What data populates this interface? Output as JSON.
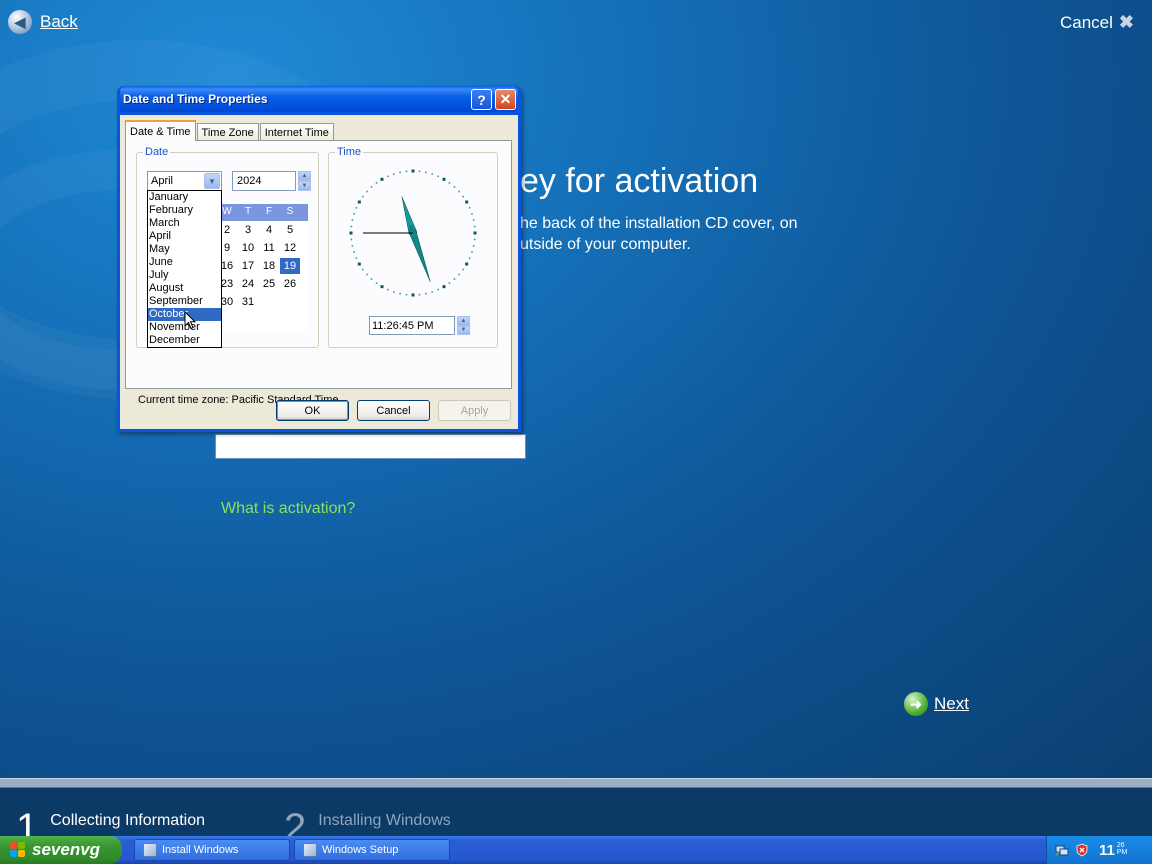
{
  "setup": {
    "back_label": "Back",
    "cancel_label": "Cancel",
    "heading": "ey for activation",
    "desc_line1": "he back of the installation CD cover, on",
    "desc_line2": "utside of your computer.",
    "what_link": "What is activation?",
    "next_label": "Next"
  },
  "steps": [
    {
      "num": "1",
      "label": "Collecting Information"
    },
    {
      "num": "2",
      "label": "Installing Windows"
    }
  ],
  "taskbar": {
    "start_label": "sevenvg",
    "tasks": [
      "Install Windows",
      "Windows Setup"
    ],
    "clock_hour": "11",
    "clock_min": "26",
    "clock_ampm": "PM"
  },
  "dialog": {
    "title": "Date and Time Properties",
    "help_glyph": "?",
    "close_glyph": "✕",
    "tabs": [
      "Date & Time",
      "Time Zone",
      "Internet Time"
    ],
    "date_group": "Date",
    "time_group": "Time",
    "month_value": "April",
    "year_value": "2024",
    "weekday_headers": [
      "W",
      "T",
      "F",
      "S"
    ],
    "calendar_rows": [
      [
        "2",
        "3",
        "4",
        "5"
      ],
      [
        "9",
        "10",
        "11",
        "12"
      ],
      [
        "16",
        "17",
        "18",
        "19"
      ],
      [
        "23",
        "24",
        "25",
        "26"
      ],
      [
        "30",
        "31",
        "",
        ""
      ]
    ],
    "selected_day": "19",
    "months": [
      "January",
      "February",
      "March",
      "April",
      "May",
      "June",
      "July",
      "August",
      "September",
      "October",
      "November",
      "December"
    ],
    "highlighted_month": "October",
    "time_value": "11:26:45 PM",
    "timezone_text": "Current time zone:  Pacific Standard Time",
    "ok_label": "OK",
    "cancel_label": "Cancel",
    "apply_label": "Apply"
  },
  "clock": {
    "hour": 11,
    "minute": 26,
    "second": 45
  },
  "colors": {
    "accent_blue": "#0a54e0",
    "link_green": "#8ee05a",
    "selection": "#316ac5"
  }
}
